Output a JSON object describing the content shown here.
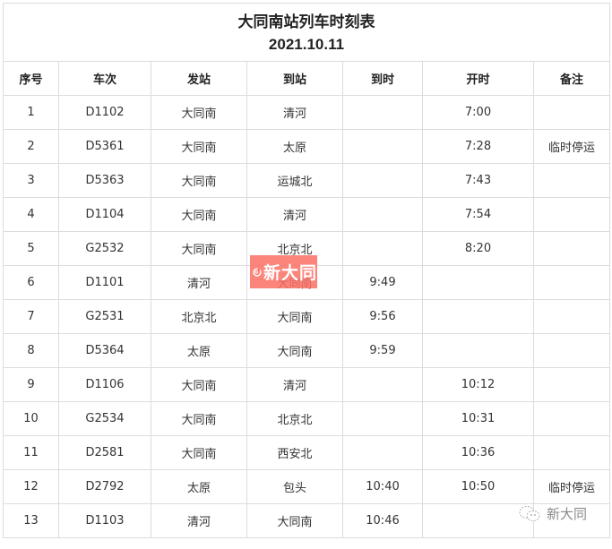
{
  "document": {
    "title": "大同南站列车时刻表",
    "date": "2021.10.11"
  },
  "table": {
    "headers": [
      "序号",
      "车次",
      "发站",
      "到站",
      "到时",
      "开时",
      "备注"
    ],
    "rows": [
      {
        "no": "1",
        "train": "D1102",
        "from": "大同南",
        "to": "清河",
        "arrive": "",
        "depart": "7:00",
        "note": ""
      },
      {
        "no": "2",
        "train": "D5361",
        "from": "大同南",
        "to": "太原",
        "arrive": "",
        "depart": "7:28",
        "note": "临时停运"
      },
      {
        "no": "3",
        "train": "D5363",
        "from": "大同南",
        "to": "运城北",
        "arrive": "",
        "depart": "7:43",
        "note": ""
      },
      {
        "no": "4",
        "train": "D1104",
        "from": "大同南",
        "to": "清河",
        "arrive": "",
        "depart": "7:54",
        "note": ""
      },
      {
        "no": "5",
        "train": "G2532",
        "from": "大同南",
        "to": "北京北",
        "arrive": "",
        "depart": "8:20",
        "note": ""
      },
      {
        "no": "6",
        "train": "D1101",
        "from": "清河",
        "to": "大同南",
        "arrive": "9:49",
        "depart": "",
        "note": ""
      },
      {
        "no": "7",
        "train": "G2531",
        "from": "北京北",
        "to": "大同南",
        "arrive": "9:56",
        "depart": "",
        "note": ""
      },
      {
        "no": "8",
        "train": "D5364",
        "from": "太原",
        "to": "大同南",
        "arrive": "9:59",
        "depart": "",
        "note": ""
      },
      {
        "no": "9",
        "train": "D1106",
        "from": "大同南",
        "to": "清河",
        "arrive": "",
        "depart": "10:12",
        "note": ""
      },
      {
        "no": "10",
        "train": "G2534",
        "from": "大同南",
        "to": "北京北",
        "arrive": "",
        "depart": "10:31",
        "note": ""
      },
      {
        "no": "11",
        "train": "D2581",
        "from": "大同南",
        "to": "西安北",
        "arrive": "",
        "depart": "10:36",
        "note": ""
      },
      {
        "no": "12",
        "train": "D2792",
        "from": "太原",
        "to": "包头",
        "arrive": "10:40",
        "depart": "10:50",
        "note": "临时停运"
      },
      {
        "no": "13",
        "train": "D1103",
        "from": "清河",
        "to": "大同南",
        "arrive": "10:46",
        "depart": "",
        "note": ""
      }
    ]
  },
  "watermarks": {
    "logo_text": "新大同",
    "logo_color": "#fa6e64",
    "wechat_text": "新大同"
  }
}
